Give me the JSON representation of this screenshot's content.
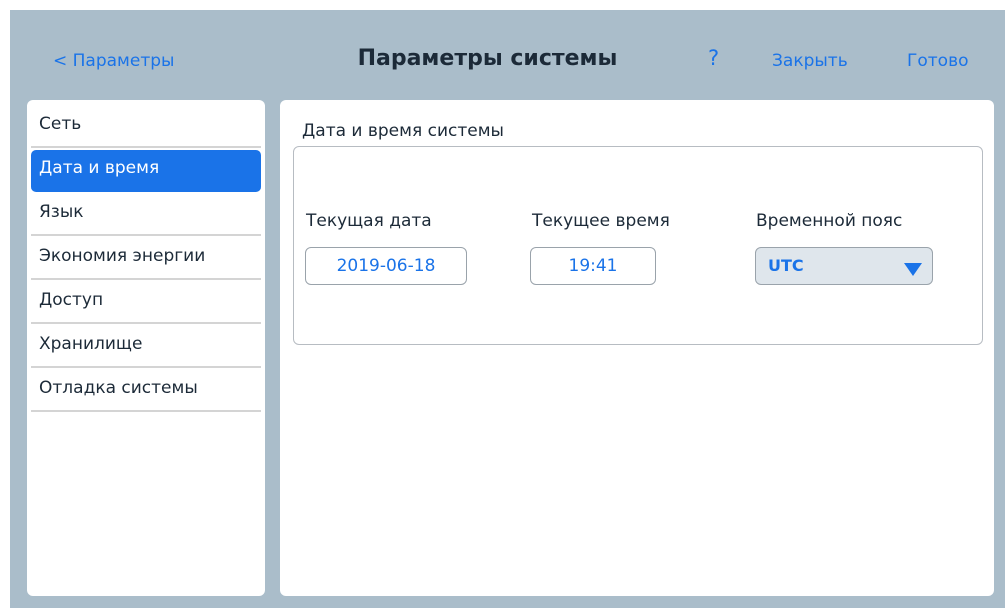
{
  "header": {
    "back_label": "< Параметры",
    "title": "Параметры системы",
    "help_label": "?",
    "close_label": "Закрыть",
    "done_label": "Готово"
  },
  "sidebar": {
    "items": [
      {
        "label": "Сеть",
        "active": false
      },
      {
        "label": "Дата и время",
        "active": true
      },
      {
        "label": "Язык",
        "active": false
      },
      {
        "label": "Экономия энергии",
        "active": false
      },
      {
        "label": "Доступ",
        "active": false
      },
      {
        "label": "Хранилище",
        "active": false
      },
      {
        "label": "Отладка системы",
        "active": false
      }
    ]
  },
  "main": {
    "section_title": "Дата и время системы",
    "date": {
      "label": "Текущая дата",
      "value": "2019-06-18"
    },
    "time": {
      "label": "Текущее время",
      "value": "19:41"
    },
    "timezone": {
      "label": "Временной пояс",
      "value": "UTC"
    }
  },
  "colors": {
    "accent": "#1a73e8",
    "frame_background": "#aabdca",
    "panel_background": "#ffffff",
    "select_background": "#dfe6ec"
  },
  "icons": {
    "dropdown": "chevron-down-icon"
  }
}
